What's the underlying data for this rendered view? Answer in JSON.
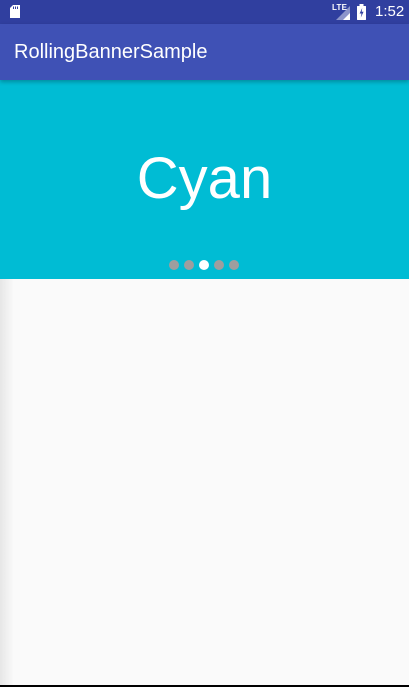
{
  "status_bar": {
    "network_label": "LTE",
    "time": "1:52",
    "icons": [
      "sd-card-icon",
      "signal-icon",
      "battery-icon"
    ]
  },
  "app_bar": {
    "title": "RollingBannerSample"
  },
  "banner": {
    "text": "Cyan",
    "background_color": "#00bcd4",
    "page_count": 5,
    "current_page": 3
  },
  "colors": {
    "status_bar": "#303f9f",
    "app_bar": "#3f51b5",
    "indicator_inactive": "#9e9e9e",
    "indicator_active": "#ffffff"
  }
}
